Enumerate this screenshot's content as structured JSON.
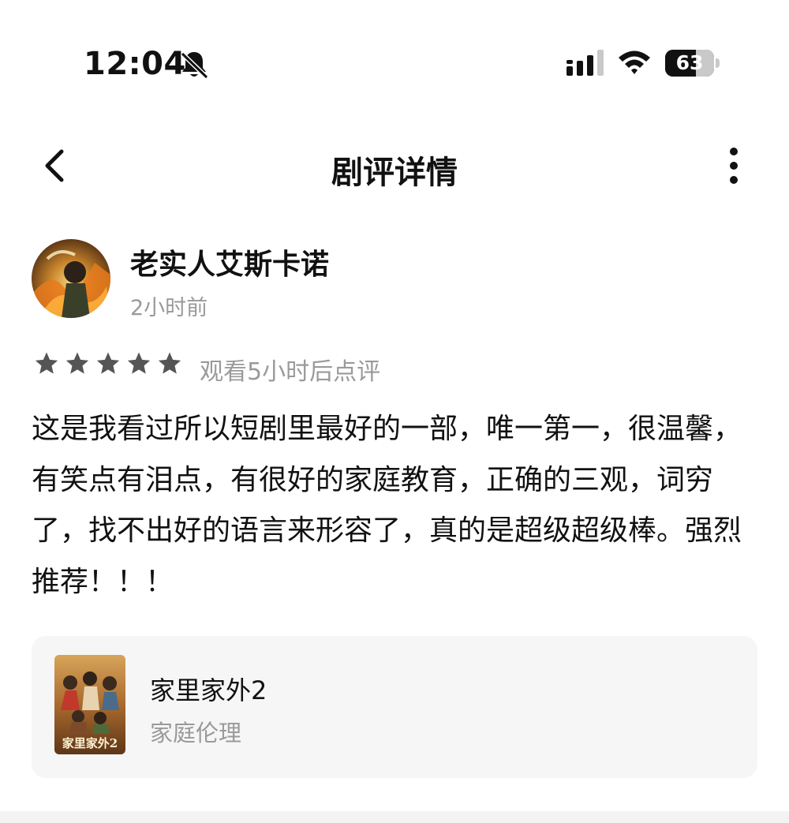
{
  "status_bar": {
    "time": "12:04",
    "bell_icon": "bell-muted-icon",
    "signal_icon": "cellular-signal-icon",
    "wifi_icon": "wifi-icon",
    "battery_level": "63",
    "battery_fraction": 0.63
  },
  "nav": {
    "back_icon": "chevron-left-icon",
    "title": "剧评详情",
    "more_icon": "more-vertical-icon"
  },
  "author": {
    "name": "老实人艾斯卡诺",
    "time": "2小时前"
  },
  "rating": {
    "stars": 5,
    "max_stars": 5,
    "star_color": "#555555",
    "note": "观看5小时后点评"
  },
  "review": {
    "text": "这是我看过所以短剧里最好的一部，唯一第一，很温馨，有笑点有泪点，有很好的家庭教育，正确的三观，词穷了，找不出好的语言来形容了，真的是超级超级棒。强烈推荐！！！"
  },
  "drama": {
    "title": "家里家外2",
    "genre": "家庭伦理",
    "poster_text": "家里家外2"
  }
}
